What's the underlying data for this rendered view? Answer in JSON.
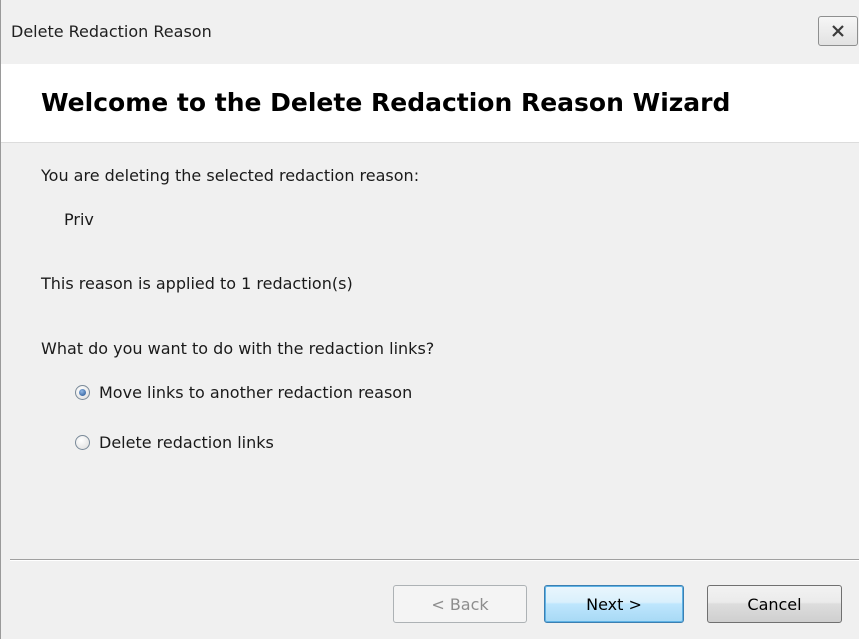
{
  "window": {
    "title": "Delete Redaction Reason",
    "close_glyph": "✕"
  },
  "header": {
    "title": "Welcome to the Delete Redaction Reason Wizard"
  },
  "content": {
    "deleting_label": "You are deleting the selected redaction reason:",
    "reason_name": "Priv",
    "applied_text": "This reason is applied to 1 redaction(s)",
    "question": "What do you want to do with the redaction links?",
    "options": [
      {
        "label": "Move links to another redaction reason",
        "selected": true
      },
      {
        "label": "Delete redaction links",
        "selected": false
      }
    ]
  },
  "buttons": {
    "back": "< Back",
    "next": "Next >",
    "cancel": "Cancel"
  },
  "colors": {
    "dialog_bg": "#f0f0f0",
    "header_bg": "#ffffff",
    "default_button_border": "#3c7fb1"
  }
}
